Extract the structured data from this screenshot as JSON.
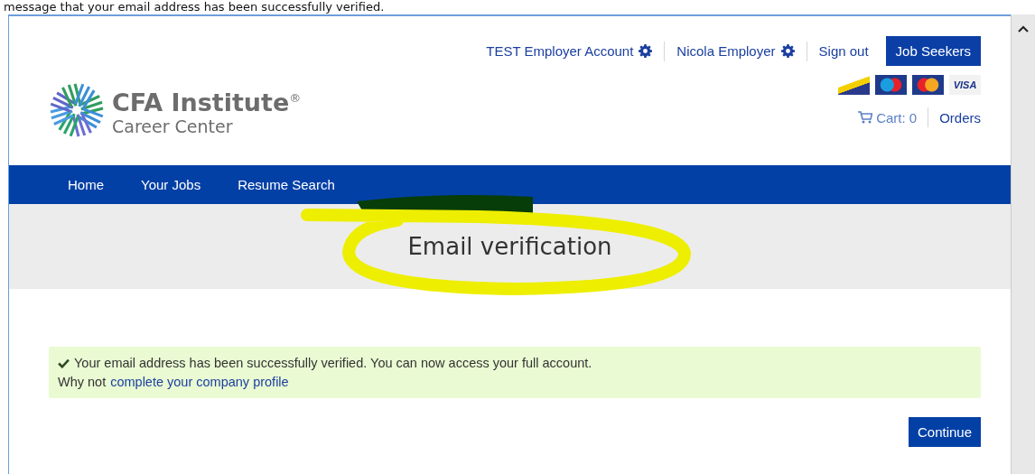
{
  "caption": "message that your email address has been successfully verified.",
  "account_links": [
    {
      "label": "TEST Employer Account",
      "gear": true
    },
    {
      "label": "Nicola Employer",
      "gear": true
    },
    {
      "label": "Sign out",
      "gear": false
    }
  ],
  "job_seekers_button": "Job Seekers",
  "logo": {
    "title": "CFA Institute",
    "registered": "®",
    "subtitle": "Career Center"
  },
  "payment_cards": [
    {
      "kind": "delta"
    },
    {
      "kind": "maestro"
    },
    {
      "kind": "mastercard"
    },
    {
      "kind": "visa",
      "label": "VISA"
    }
  ],
  "cart": "Cart: 0",
  "orders": "Orders",
  "nav": [
    {
      "label": "Home"
    },
    {
      "label": "Your Jobs"
    },
    {
      "label": "Resume Search"
    }
  ],
  "page_title": "Email verification",
  "alert": {
    "message": "Your email address has been successfully verified. You can now access your full account.",
    "prompt": "Why not",
    "link": "complete your company profile"
  },
  "continue_button": "Continue"
}
